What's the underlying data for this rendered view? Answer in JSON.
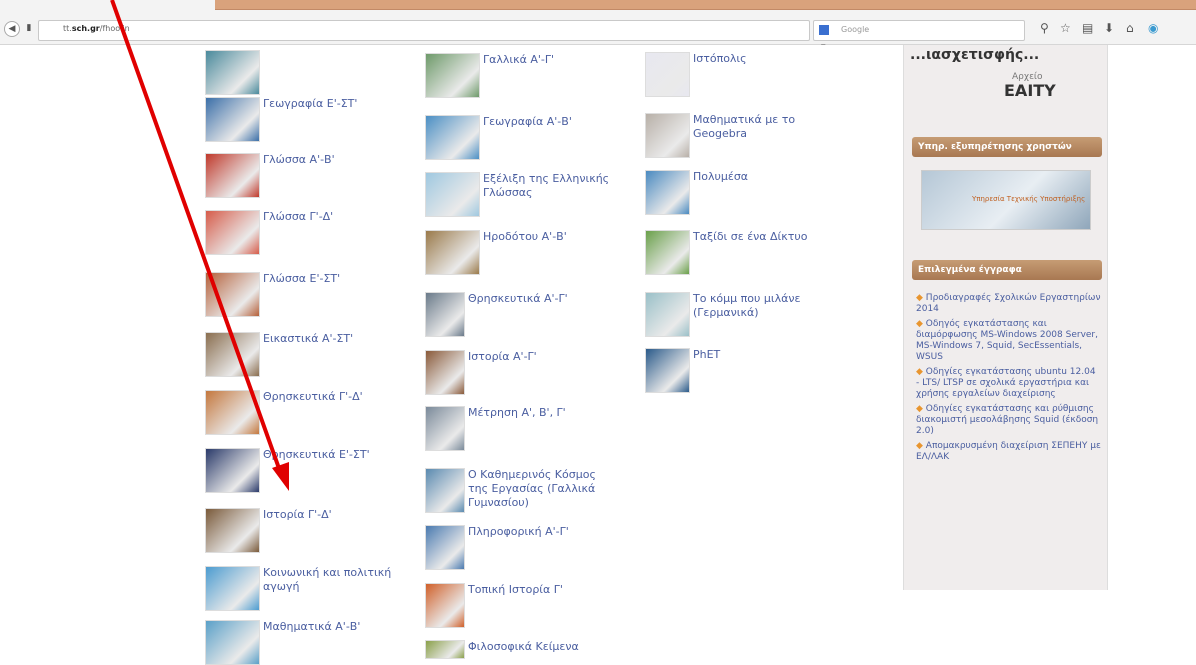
{
  "browser": {
    "url_prefix": "tt.",
    "url_highlight": "sch.gr",
    "url_suffix": "/fhoolin",
    "search_placeholder": "Google",
    "nav_back_icon": "back-arrow-icon",
    "reload_label": "▾ C"
  },
  "columns": [
    {
      "items": [
        {
          "label": "",
          "color": "#4a8a9c"
        },
        {
          "label": "Γεωγραφία Ε'-ΣΤ'",
          "color": "#3b6fa8"
        },
        {
          "label": "Γλώσσα Α'-Β'",
          "color": "#c0392b"
        },
        {
          "label": "Γλώσσα Γ'-Δ'",
          "color": "#d65c4a"
        },
        {
          "label": "Γλώσσα Ε'-ΣΤ'",
          "color": "#b5603a"
        },
        {
          "label": "Εικαστικά Α'-ΣΤ'",
          "color": "#8a6e4f"
        },
        {
          "label": "Θρησκευτικά Γ'-Δ'",
          "color": "#c4783e"
        },
        {
          "label": "Θρησκευτικά Ε'-ΣΤ'",
          "color": "#2a3a6a"
        },
        {
          "label": "Ιστορία Γ'-Δ'",
          "color": "#7a5a3a"
        },
        {
          "label": "Κοινωνική και πολιτική αγωγή",
          "color": "#4c9cd0"
        },
        {
          "label": "Μαθηματικά Α'-Β'",
          "color": "#5aa0c8"
        }
      ]
    },
    {
      "items": [
        {
          "label": "Γαλλικά Α'-Γ'",
          "color": "#6e9a6a"
        },
        {
          "label": "Γεωγραφία Α'-Β'",
          "color": "#4b8fc4"
        },
        {
          "label": "Εξέλιξη της Ελληνικής Γλώσσας",
          "color": "#9fc8e0"
        },
        {
          "label": "Ηροδότου Α'-Β'",
          "color": "#9a7a4a"
        },
        {
          "label": "Θρησκευτικά Α'-Γ'",
          "color": "#6a7a8a"
        },
        {
          "label": "Ιστορία Α'-Γ'",
          "color": "#8a5a3a"
        },
        {
          "label": "Μέτρηση Α', Β', Γ'",
          "color": "#7a8a9a"
        },
        {
          "label": "Ο Καθημερινός Κόσμος της Εργασίας (Γαλλικά Γυμνασίου)",
          "color": "#5a8ab0"
        },
        {
          "label": "Πληροφορική Α'-Γ'",
          "color": "#4a7ab0"
        },
        {
          "label": "Τοπική Ιστορία Γ'",
          "color": "#d0602a"
        },
        {
          "label": "Φιλοσοφικά Κείμενα",
          "color": "#8aa04a"
        }
      ]
    },
    {
      "items": [
        {
          "label": "Ιστόπολις",
          "color": "#e8e8f0"
        },
        {
          "label": "Μαθηματικά με το Geogebra",
          "color": "#b8b0a8"
        },
        {
          "label": "Πολυμέσα",
          "color": "#4a8ac0"
        },
        {
          "label": "Ταξίδι σε ένα Δίκτυο",
          "color": "#6aa04a"
        },
        {
          "label": "Το κόμμ που μιλάνε (Γερμανικά)",
          "color": "#9ac0c8"
        },
        {
          "label": "PhET",
          "color": "#2a5a8a"
        }
      ]
    }
  ],
  "sidebar": {
    "partial_heading": "...ιασχετισφής...",
    "archive_label": "Αρχείο",
    "eaity_label": "EAITY",
    "support_section": "Υπηρ. εξυπηρέτησης χρηστών",
    "banner_text": "Υπηρεσία Τεχνικής Υποστήριξης",
    "selected_docs_section": "Επιλεγμένα έγγραφα",
    "docs": [
      "Προδιαγραφές Σχολικών Εργαστηρίων 2014",
      "Οδηγός εγκατάστασης και διαμόρφωσης MS-Windows 2008 Server, MS-Windows 7, Squid, SecEssentials, WSUS",
      "Οδηγίες εγκατάστασης ubuntu 12.04 - LTS/ LTSP σε σχολικά εργαστήρια και χρήσης εργαλείων διαχείρισης",
      "Οδηγίες εγκατάστασης και ρύθμισης διακομιστή μεσολάβησης Squid (έκδοση 2.0)",
      "Απομακρυσμένη διαχείριση ΣΕΠΕΗΥ με ΕΛ/ΛΑΚ"
    ]
  },
  "colors": {
    "arrow": "#e00000",
    "link": "#4a5ea0",
    "section": "#b0825a"
  }
}
